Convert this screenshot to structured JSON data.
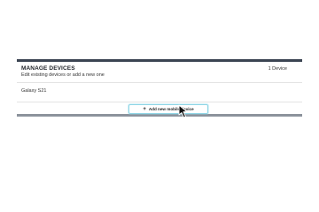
{
  "panel": {
    "title": "MANAGE DEVICES",
    "subtitle": "Edit existing devices or add a new one",
    "count": "1 Device"
  },
  "devices": [
    {
      "name": "Galaxy S21"
    }
  ],
  "actions": {
    "add_icon": "plus-icon",
    "add_label": "Add new mobile device"
  },
  "colors": {
    "header_border": "#3b4452",
    "button_border": "#8fd6e6"
  }
}
